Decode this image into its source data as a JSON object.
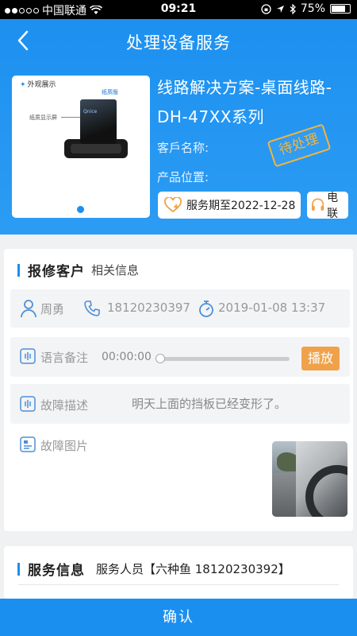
{
  "status_bar": {
    "carrier": "中国联通",
    "time": "09:21",
    "battery": "75%"
  },
  "nav": {
    "title": "处理设备服务",
    "back_icon": "back-arrow-icon"
  },
  "product": {
    "image_tag": "外观展示",
    "image_subtag": "纸质版",
    "image_label": "纸质显示屏",
    "image_screen_text": "Qnice",
    "name": "线路解决方案-桌面线路-DH-47XX系列",
    "customer_label": "客戶名称:",
    "location_label": "产品位置:",
    "status_stamp": "待处理",
    "service_period": "服务期至2022-12-28",
    "contact_label": "电联"
  },
  "repair_section": {
    "title": "报修客户",
    "subtitle": "相关信息",
    "customer_name": "周勇",
    "phone": "18120230397",
    "datetime": "2019-01-08 13:37",
    "voice_label": "语言备注",
    "voice_time": "00:00:00",
    "play_label": "播放",
    "fault_desc_label": "故障描述",
    "fault_desc": "明天上面的挡板已经变形了。",
    "fault_img_label": "故障图片"
  },
  "service_section": {
    "title": "服务信息",
    "subtitle": "服务人员【六种鱼 18120230392】"
  },
  "footer": {
    "confirm_label": "确认"
  },
  "colors": {
    "primary": "#1b8ff0",
    "accent_orange": "#f0a24b",
    "stamp": "#f5b43a"
  }
}
